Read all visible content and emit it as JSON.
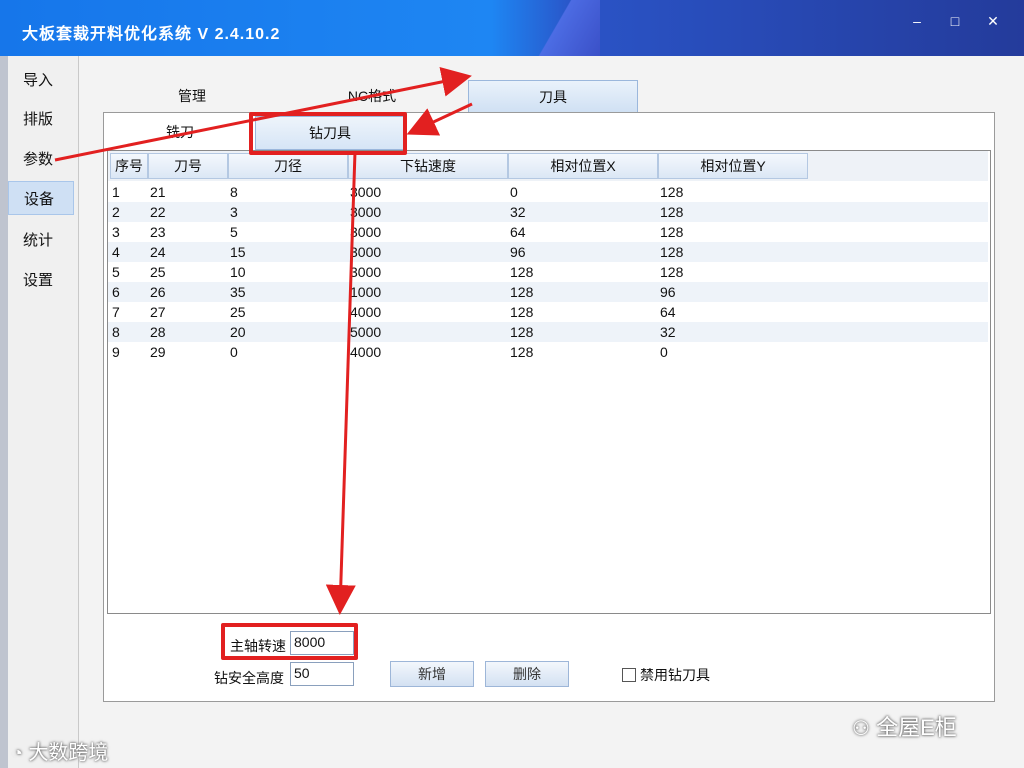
{
  "window": {
    "title": "大板套裁开料优化系统 V 2.4.10.2"
  },
  "nav": {
    "items": [
      "导入",
      "排版",
      "参数",
      "设备",
      "统计",
      "设置"
    ],
    "active": 3
  },
  "tabs": {
    "top": [
      "管理",
      "NC格式",
      "刀具"
    ],
    "active": 2,
    "sub": [
      "铣刀",
      "钻刀具"
    ],
    "sub_active": 1
  },
  "table": {
    "headers": [
      "序号",
      "刀号",
      "刀径",
      "下钻速度",
      "相对位置X",
      "相对位置Y"
    ],
    "rows": [
      [
        "1",
        "21",
        "8",
        "3000",
        "0",
        "128"
      ],
      [
        "2",
        "22",
        "3",
        "3000",
        "32",
        "128"
      ],
      [
        "3",
        "23",
        "5",
        "3000",
        "64",
        "128"
      ],
      [
        "4",
        "24",
        "15",
        "3000",
        "96",
        "128"
      ],
      [
        "5",
        "25",
        "10",
        "3000",
        "128",
        "128"
      ],
      [
        "6",
        "26",
        "35",
        "1000",
        "128",
        "96"
      ],
      [
        "7",
        "27",
        "25",
        "4000",
        "128",
        "64"
      ],
      [
        "8",
        "28",
        "20",
        "5000",
        "128",
        "32"
      ],
      [
        "9",
        "29",
        "0",
        "4000",
        "128",
        "0"
      ]
    ]
  },
  "form": {
    "spindle_label": "主轴转速",
    "spindle_value": "8000",
    "safe_height_label": "钻安全高度",
    "safe_height_value": "50",
    "add_label": "新增",
    "delete_label": "删除",
    "disable_label": "禁用钻刀具"
  },
  "watermarks": {
    "left": "大数跨境",
    "right": "全屋E柜"
  },
  "colors": {
    "accent": "#1e86f3",
    "annotation": "#e22020"
  }
}
